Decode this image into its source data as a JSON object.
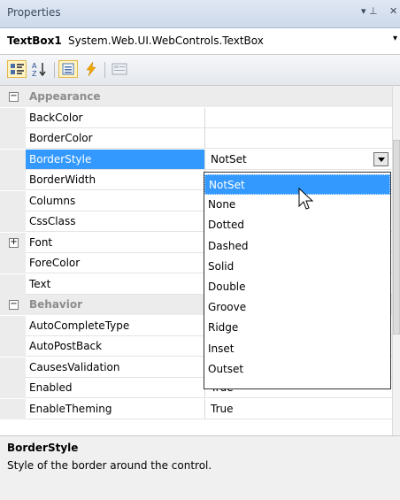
{
  "titlebar": {
    "title": "Properties",
    "pin": "▾ ⊥",
    "close": "✕"
  },
  "object": {
    "name": "TextBox1",
    "type": "System.Web.UI.WebControls.TextBox",
    "dropdown": "▾"
  },
  "toolbar": {
    "lightning_color": "#f0a800"
  },
  "rows": [
    {
      "kind": "category",
      "name": "Appearance",
      "toggle": "−"
    },
    {
      "kind": "prop",
      "name": "BackColor",
      "value": ""
    },
    {
      "kind": "prop",
      "name": "BorderColor",
      "value": ""
    },
    {
      "kind": "prop",
      "name": "BorderStyle",
      "value": "NotSet",
      "selected": true
    },
    {
      "kind": "prop",
      "name": "BorderWidth",
      "value": ""
    },
    {
      "kind": "prop",
      "name": "Columns",
      "value": ""
    },
    {
      "kind": "prop",
      "name": "CssClass",
      "value": ""
    },
    {
      "kind": "prop",
      "name": "Font",
      "value": "",
      "expand": "+"
    },
    {
      "kind": "prop",
      "name": "ForeColor",
      "value": ""
    },
    {
      "kind": "prop",
      "name": "Text",
      "value": ""
    },
    {
      "kind": "category",
      "name": "Behavior",
      "toggle": "−"
    },
    {
      "kind": "prop",
      "name": "AutoCompleteType",
      "value": ""
    },
    {
      "kind": "prop",
      "name": "AutoPostBack",
      "value": ""
    },
    {
      "kind": "prop",
      "name": "CausesValidation",
      "value": ""
    },
    {
      "kind": "prop",
      "name": "Enabled",
      "value": "True"
    },
    {
      "kind": "prop",
      "name": "EnableTheming",
      "value": "True"
    }
  ],
  "dropdown_options": [
    "NotSet",
    "None",
    "Dotted",
    "Dashed",
    "Solid",
    "Double",
    "Groove",
    "Ridge",
    "Inset",
    "Outset"
  ],
  "description": {
    "title": "BorderStyle",
    "text": "Style of the border around the control."
  }
}
